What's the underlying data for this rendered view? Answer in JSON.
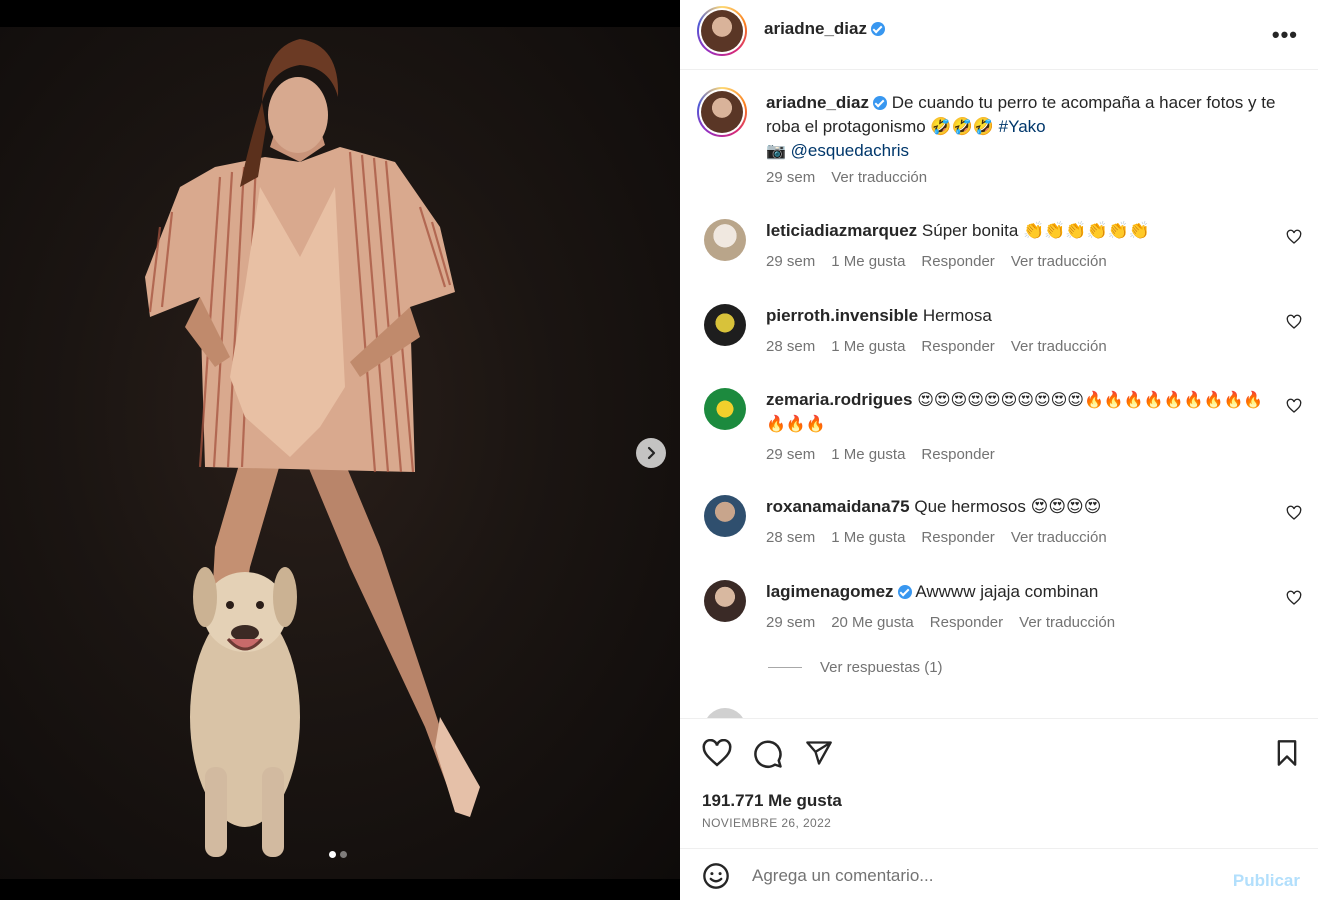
{
  "post": {
    "username": "ariadne_diaz",
    "more_label": "•••"
  },
  "caption": {
    "username": "ariadne_diaz",
    "text": "De cuando tu perro te acompaña a hacer fotos y te roba el protagonismo 🤣🤣🤣",
    "hashtag": "#Yako",
    "camera_emoji": "📷",
    "mention": "@esquedachris",
    "time": "29 sem",
    "translate": "Ver traducción"
  },
  "comments": [
    {
      "username": "leticiadiazmarquez",
      "text": "Súper bonita 👏👏👏👏👏👏",
      "time": "29 sem",
      "likes": "1 Me gusta",
      "reply": "Responder",
      "translate": "Ver traducción",
      "verified": false
    },
    {
      "username": "pierroth.invensible",
      "text": "Hermosa",
      "time": "28 sem",
      "likes": "1 Me gusta",
      "reply": "Responder",
      "translate": "Ver traducción",
      "verified": false
    },
    {
      "username": "zemaria.rodrigues",
      "text": "😍😍😍😍😍😍😍😍😍😍🔥🔥🔥🔥🔥🔥🔥🔥🔥🔥🔥🔥",
      "time": "29 sem",
      "likes": "1 Me gusta",
      "reply": "Responder",
      "translate": "",
      "verified": false
    },
    {
      "username": "roxanamaidana75",
      "text": "Que hermosos 😍😍😍😍",
      "time": "28 sem",
      "likes": "1 Me gusta",
      "reply": "Responder",
      "translate": "Ver traducción",
      "verified": false
    },
    {
      "username": "lagimenagomez",
      "text": "Awwww jajaja combinan",
      "time": "29 sem",
      "likes": "20 Me gusta",
      "reply": "Responder",
      "translate": "Ver traducción",
      "verified": true
    }
  ],
  "view_replies": "Ver respuestas (1)",
  "footer": {
    "likes": "191.771 Me gusta",
    "date": "NOVIEMBRE 26, 2022"
  },
  "compose": {
    "placeholder": "Agrega un comentario...",
    "publish": "Publicar"
  },
  "colors": {
    "accent": "#0095f6",
    "link": "#00376b",
    "muted": "#737373",
    "verified": "#3897f0"
  },
  "icons": [
    "chevron-right-icon",
    "heart-icon",
    "comment-icon",
    "share-icon",
    "bookmark-icon",
    "emoji-icon",
    "verified-icon",
    "more-icon"
  ]
}
